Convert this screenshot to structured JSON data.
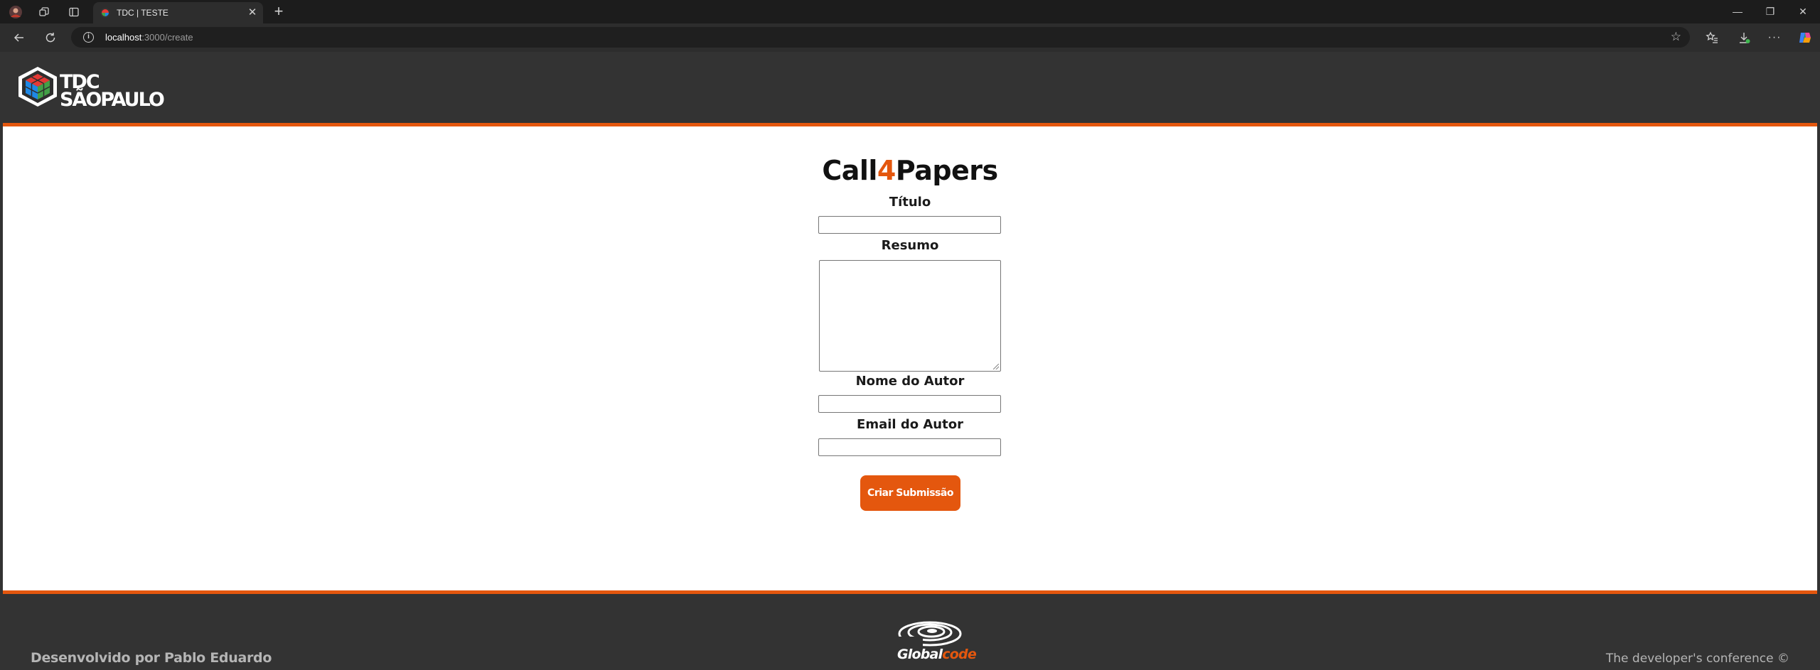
{
  "browser": {
    "tab_title": "TDC | TESTE",
    "tab_close": "✕",
    "new_tab": "+",
    "url_host": "localhost",
    "url_rest": ":3000/create",
    "minimize": "—",
    "restore": "❐",
    "close": "✕",
    "more": "···"
  },
  "header": {
    "logo_line1": "TDC",
    "logo_line2": "SÃOPAULO"
  },
  "form": {
    "title_part1": "Call",
    "title_accent": "4",
    "title_part2": "Papers",
    "titulo_label": "Título",
    "resumo_label": "Resumo",
    "autor_label": "Nome do Autor",
    "email_label": "Email do Autor",
    "submit_label": "Criar Submissão"
  },
  "footer": {
    "left_text": "Desenvolvido por Pablo Eduardo",
    "logo_global": "Global",
    "logo_code": "code",
    "right_text": "The developer's conference ©"
  },
  "colors": {
    "accent": "#e4570e",
    "page_dark": "#333333",
    "content_bg": "#ffffff"
  }
}
